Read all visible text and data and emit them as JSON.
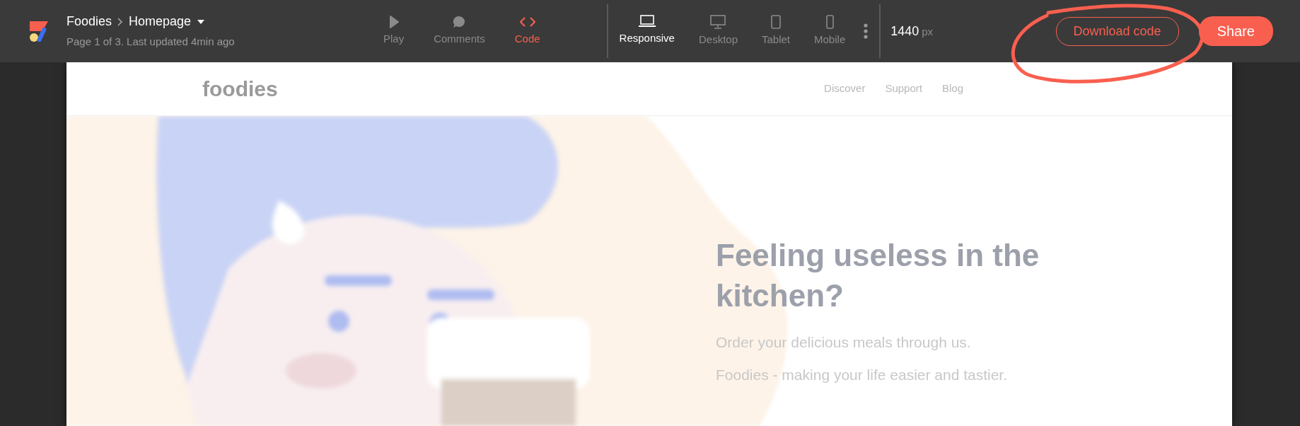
{
  "project": {
    "name": "Foodies",
    "page": "Homepage",
    "subtitle": "Page 1 of 3. Last updated 4min ago"
  },
  "modes": [
    {
      "label": "Play",
      "kind": "play",
      "selected": false
    },
    {
      "label": "Comments",
      "kind": "comments",
      "selected": false
    },
    {
      "label": "Code",
      "kind": "code",
      "selected": true
    }
  ],
  "devices": [
    {
      "label": "Responsive",
      "kind": "laptop",
      "selected": true
    },
    {
      "label": "Desktop",
      "kind": "desktop",
      "selected": false
    },
    {
      "label": "Tablet",
      "kind": "tablet",
      "selected": false
    },
    {
      "label": "Mobile",
      "kind": "mobile",
      "selected": false
    }
  ],
  "width": {
    "value": "1440",
    "unit": "px"
  },
  "buttons": [
    {
      "label": "Download code",
      "kind": "outline"
    },
    {
      "label": "Share",
      "kind": "filled"
    }
  ],
  "preview": {
    "logo": "foodies",
    "nav": [
      "Discover",
      "Support",
      "Blog"
    ],
    "heading": "Feeling useless in the kitchen?",
    "lines": [
      "Order your delicious meals through us.",
      "Foodies - making your life easier and tastier."
    ]
  }
}
